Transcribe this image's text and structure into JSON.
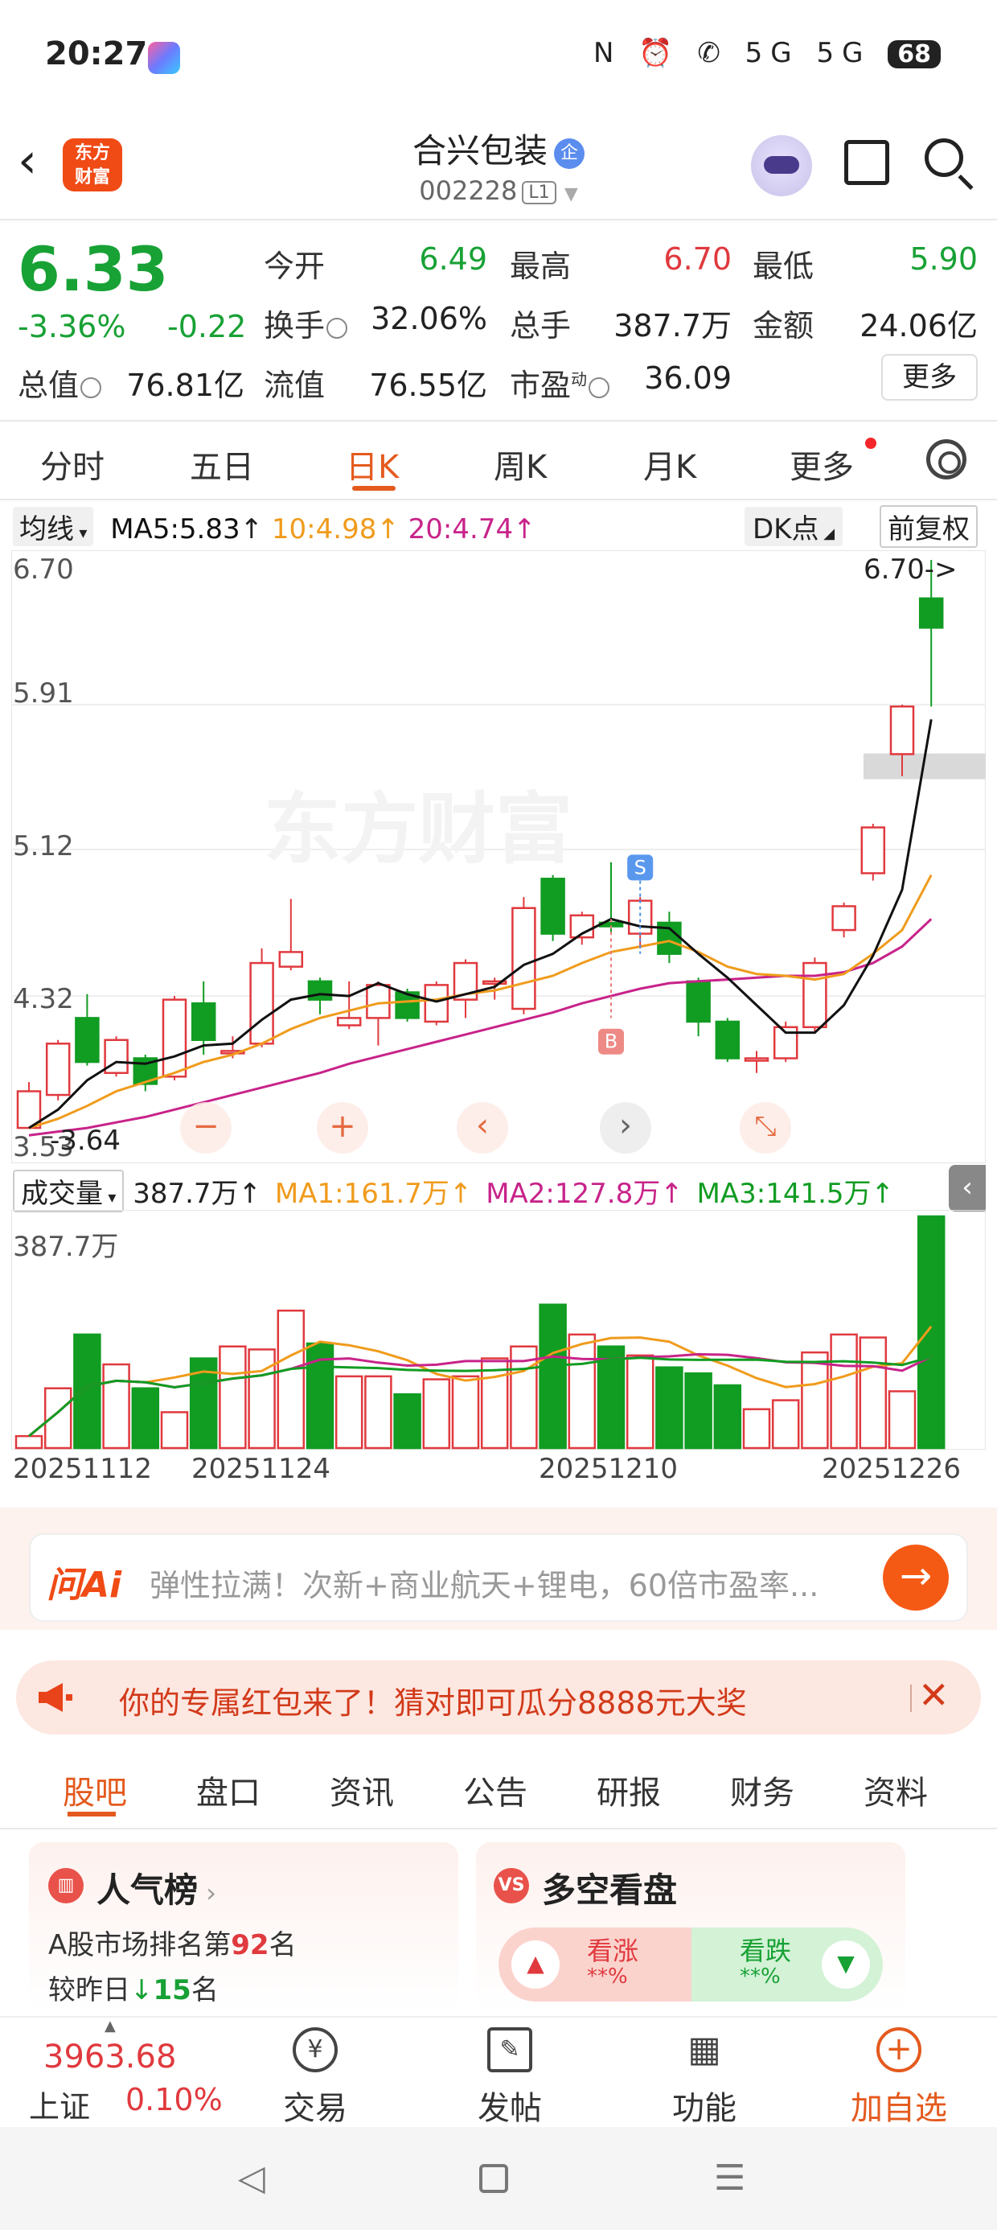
{
  "status_bar": {
    "time": "20:27",
    "battery": "68",
    "icons": "N ⏰ ✆ 5G 5G"
  },
  "header": {
    "logo_text_1": "东方",
    "logo_text_2": "财富",
    "stock_name": "合兴包装",
    "badge": "企",
    "stock_code": "002228",
    "level": "L1"
  },
  "quote": {
    "price": "6.33",
    "change_pct": "-3.36%",
    "change": "-0.22",
    "open_label": "今开",
    "open": "6.49",
    "high_label": "最高",
    "high": "6.70",
    "low_label": "最低",
    "low": "5.90",
    "turnover_label": "换手",
    "turnover": "32.06%",
    "volume_label": "总手",
    "volume": "387.7万",
    "amount_label": "金额",
    "amount": "24.06亿",
    "mktcap_label": "总值",
    "mktcap": "76.81亿",
    "float_label": "流值",
    "float": "76.55亿",
    "pe_label": "市盈",
    "pe_sup": "动",
    "pe": "36.09",
    "more": "更多"
  },
  "period_tabs": [
    "分时",
    "五日",
    "日K",
    "周K",
    "月K",
    "更多"
  ],
  "ma_legend": {
    "selector": "均线",
    "ma5": "MA5:5.83",
    "ma10": "10:4.98",
    "ma20": "20:4.74",
    "dk": "DK点",
    "adjust": "前复权"
  },
  "colors": {
    "up": "#e0393e",
    "down": "#119c22",
    "accent": "#e45a1e",
    "ma5": "#111111",
    "ma10": "#f09b1c",
    "ma20": "#c8238a"
  },
  "chart": {
    "y_labels": [
      "6.70",
      "5.91",
      "5.12",
      "4.32",
      "3.53"
    ],
    "high_marker": "6.70->",
    "low_marker": "3.64",
    "signal_s": "S",
    "signal_b": "B"
  },
  "chart_data": {
    "type": "candlestick",
    "ylim": [
      3.53,
      6.7
    ],
    "candles": [
      {
        "o": 3.6,
        "c": 3.8,
        "h": 3.85,
        "l": 3.6
      },
      {
        "o": 3.78,
        "c": 4.06,
        "h": 4.08,
        "l": 3.75
      },
      {
        "o": 4.2,
        "c": 3.96,
        "h": 4.33,
        "l": 3.94
      },
      {
        "o": 3.9,
        "c": 4.08,
        "h": 4.1,
        "l": 3.88
      },
      {
        "o": 3.98,
        "c": 3.84,
        "h": 4.0,
        "l": 3.8
      },
      {
        "o": 3.88,
        "c": 4.3,
        "h": 4.32,
        "l": 3.86
      },
      {
        "o": 4.28,
        "c": 4.08,
        "h": 4.4,
        "l": 4.0
      },
      {
        "o": 4.02,
        "c": 4.02,
        "h": 4.1,
        "l": 3.98
      },
      {
        "o": 4.06,
        "c": 4.5,
        "h": 4.58,
        "l": 4.04
      },
      {
        "o": 4.48,
        "c": 4.56,
        "h": 4.85,
        "l": 4.46
      },
      {
        "o": 4.4,
        "c": 4.3,
        "h": 4.42,
        "l": 4.22
      },
      {
        "o": 4.16,
        "c": 4.2,
        "h": 4.4,
        "l": 4.14
      },
      {
        "o": 4.2,
        "c": 4.38,
        "h": 4.4,
        "l": 4.05
      },
      {
        "o": 4.34,
        "c": 4.2,
        "h": 4.36,
        "l": 4.18
      },
      {
        "o": 4.18,
        "c": 4.38,
        "h": 4.4,
        "l": 4.16
      },
      {
        "o": 4.3,
        "c": 4.5,
        "h": 4.52,
        "l": 4.2
      },
      {
        "o": 4.4,
        "c": 4.4,
        "h": 4.42,
        "l": 4.3
      },
      {
        "o": 4.25,
        "c": 4.8,
        "h": 4.86,
        "l": 4.22
      },
      {
        "o": 4.96,
        "c": 4.66,
        "h": 4.98,
        "l": 4.62
      },
      {
        "o": 4.64,
        "c": 4.76,
        "h": 4.78,
        "l": 4.6
      },
      {
        "o": 4.72,
        "c": 4.7,
        "h": 5.05,
        "l": 4.66
      },
      {
        "o": 4.66,
        "c": 4.84,
        "h": 4.86,
        "l": 4.58
      },
      {
        "o": 4.72,
        "c": 4.55,
        "h": 4.78,
        "l": 4.5
      },
      {
        "o": 4.4,
        "c": 4.18,
        "h": 4.42,
        "l": 4.1
      },
      {
        "o": 4.18,
        "c": 3.98,
        "h": 4.2,
        "l": 3.96
      },
      {
        "o": 3.98,
        "c": 3.98,
        "h": 4.02,
        "l": 3.9
      },
      {
        "o": 3.98,
        "c": 4.15,
        "h": 4.18,
        "l": 3.96
      },
      {
        "o": 4.15,
        "c": 4.5,
        "h": 4.53,
        "l": 4.12
      },
      {
        "o": 4.68,
        "c": 4.81,
        "h": 4.83,
        "l": 4.64
      },
      {
        "o": 4.99,
        "c": 5.24,
        "h": 5.26,
        "l": 4.95
      },
      {
        "o": 5.64,
        "c": 5.9,
        "h": 5.91,
        "l": 5.52
      },
      {
        "o": 6.49,
        "c": 6.33,
        "h": 6.7,
        "l": 5.9
      }
    ],
    "ma5": [
      3.6,
      3.7,
      3.86,
      3.96,
      3.95,
      3.99,
      4.05,
      4.06,
      4.19,
      4.3,
      4.33,
      4.32,
      4.39,
      4.33,
      4.29,
      4.33,
      4.37,
      4.49,
      4.55,
      4.66,
      4.74,
      4.7,
      4.69,
      4.55,
      4.42,
      4.27,
      4.12,
      4.12,
      4.27,
      4.54,
      4.9,
      5.83
    ],
    "ma10": [
      3.6,
      3.65,
      3.72,
      3.8,
      3.85,
      3.9,
      3.96,
      4.0,
      4.06,
      4.14,
      4.2,
      4.24,
      4.28,
      4.29,
      4.3,
      4.33,
      4.35,
      4.39,
      4.43,
      4.5,
      4.56,
      4.59,
      4.62,
      4.56,
      4.48,
      4.44,
      4.43,
      4.41,
      4.44,
      4.55,
      4.68,
      4.98
    ],
    "ma20": [
      3.56,
      3.58,
      3.6,
      3.63,
      3.66,
      3.7,
      3.74,
      3.78,
      3.82,
      3.86,
      3.9,
      3.95,
      3.99,
      4.03,
      4.07,
      4.11,
      4.15,
      4.19,
      4.23,
      4.28,
      4.32,
      4.36,
      4.39,
      4.4,
      4.41,
      4.42,
      4.43,
      4.43,
      4.45,
      4.5,
      4.59,
      4.74
    ],
    "volume": [
      20,
      100,
      190,
      140,
      100,
      60,
      150,
      170,
      165,
      230,
      175,
      120,
      120,
      90,
      115,
      120,
      150,
      170,
      240,
      190,
      170,
      155,
      135,
      125,
      105,
      65,
      80,
      160,
      190,
      185,
      95,
      387.7
    ],
    "x_dates": [
      "20251112",
      "20251124",
      "20251210",
      "20251226"
    ]
  },
  "volume_legend": {
    "selector": "成交量",
    "value": "387.7万",
    "ma1": "MA1:161.7万",
    "ma2": "MA2:127.8万",
    "ma3": "MA3:141.5万",
    "top_label": "387.7万"
  },
  "ai": {
    "logo": "问Ai",
    "text": "弹性拉满！次新+商业航天+锂电，60倍市盈率..."
  },
  "promo": {
    "text": "你的专属红包来了！猜对即可瓜分8888元大奖"
  },
  "content_tabs": [
    "股吧",
    "盘口",
    "资讯",
    "公告",
    "研报",
    "财务",
    "资料"
  ],
  "popularity": {
    "title": "人气榜",
    "rank_prefix": "A股市场排名第",
    "rank": "92",
    "rank_suffix": "名",
    "cmp_prefix": "较昨日",
    "cmp": "15",
    "cmp_suffix": "名"
  },
  "sentiment": {
    "title": "多空看盘",
    "bull": "看涨",
    "bull_val": "**%",
    "bear": "看跌",
    "bear_val": "**%"
  },
  "index": {
    "value": "3963.68",
    "name": "上证",
    "change": "0.10%"
  },
  "bottom_nav": [
    "交易",
    "发帖",
    "功能",
    "加自选"
  ]
}
